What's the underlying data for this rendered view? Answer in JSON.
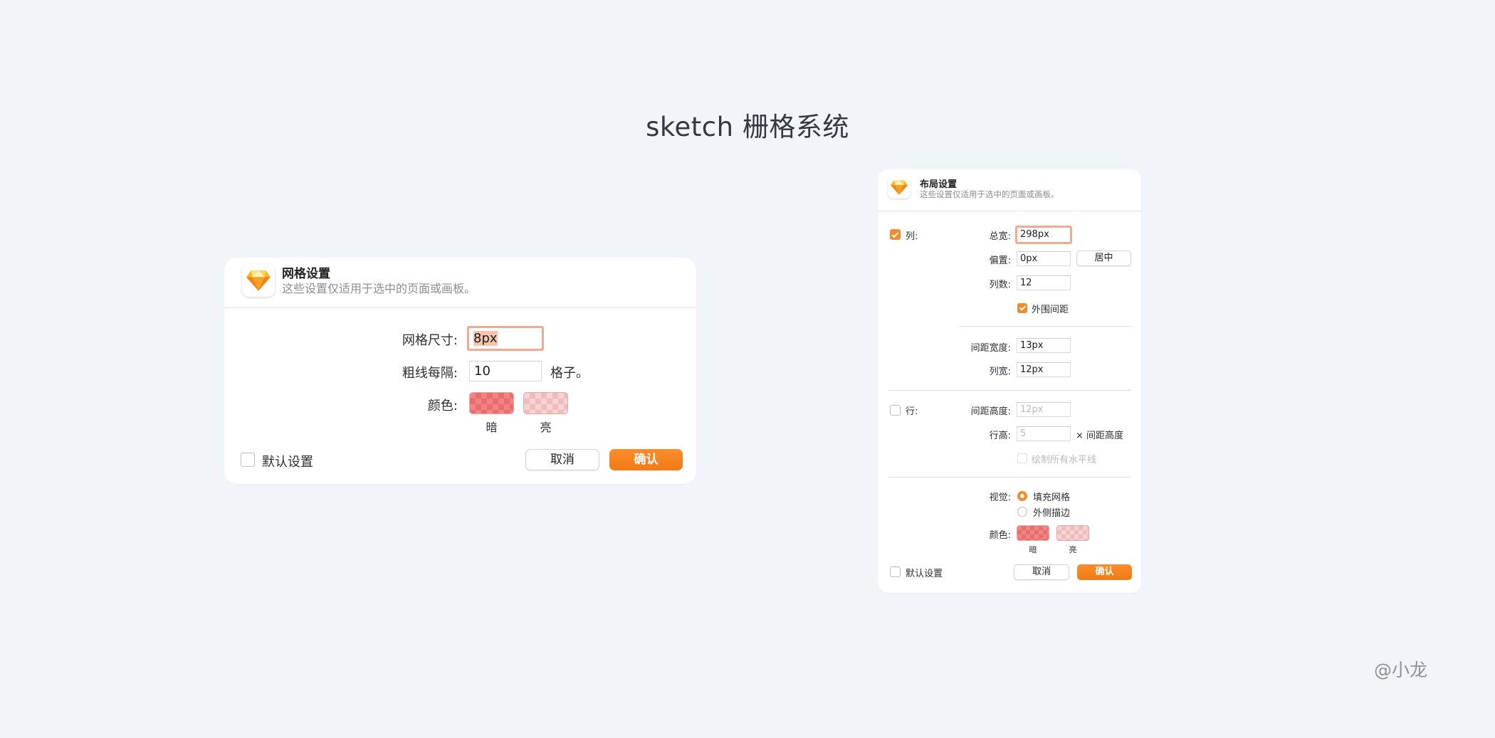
{
  "page": {
    "title": "sketch 栅格系统",
    "watermark": "@小龙"
  },
  "grid_dialog": {
    "title": "网格设置",
    "subtitle": "这些设置仅适用于选中的页面或画板。",
    "grid_size_label": "网格尺寸:",
    "grid_size_value": "8px",
    "thick_lines_label": "粗线每隔:",
    "thick_lines_value": "10",
    "thick_lines_suffix": "格子。",
    "color_label": "颜色:",
    "dark_label": "暗",
    "light_label": "亮",
    "default_label": "默认设置",
    "default_checked": false,
    "cancel_label": "取消",
    "confirm_label": "确认"
  },
  "layout_dialog": {
    "title": "布局设置",
    "subtitle": "这些设置仅适用于选中的页面或画板。",
    "columns_label": "列:",
    "columns_checked": true,
    "total_width_label": "总宽:",
    "total_width_value": "298px",
    "offset_label": "偏置:",
    "offset_value": "0px",
    "center_label": "居中",
    "count_label": "列数:",
    "count_value": "12",
    "outer_gutter_label": "外围间距",
    "outer_gutter_checked": true,
    "gutter_width_label": "间距宽度:",
    "gutter_width_value": "13px",
    "column_width_label": "列宽:",
    "column_width_value": "12px",
    "rows_label": "行:",
    "rows_checked": false,
    "gutter_height_label": "间距高度:",
    "gutter_height_value": "12px",
    "row_height_label": "行高:",
    "row_height_value": "5",
    "row_height_suffix": "× 间距高度",
    "draw_all_label": "绘制所有水平线",
    "draw_all_checked": false,
    "visual_label": "视觉:",
    "fill_grid_label": "填充网格",
    "outline_label": "外侧描边",
    "visual_selected": "填充网格",
    "color_label": "颜色:",
    "dark_label": "暗",
    "light_label": "亮",
    "default_label": "默认设置",
    "default_checked": false,
    "cancel_label": "取消",
    "confirm_label": "确认"
  },
  "colors": {
    "accent": "#f38b2d",
    "focus_ring": "#f4a98e",
    "grid_dark": "#f38484",
    "grid_light": "#f7d3d3",
    "background": "#f1f4f9"
  },
  "icons": {
    "app": "sketch-diamond-icon"
  }
}
